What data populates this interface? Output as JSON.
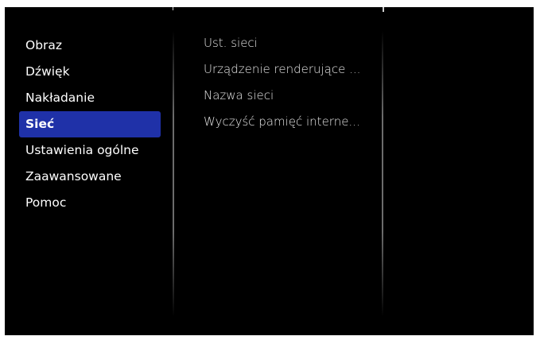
{
  "left_menu": {
    "items": [
      {
        "label": "Obraz"
      },
      {
        "label": "Dźwięk"
      },
      {
        "label": "Nakładanie"
      },
      {
        "label": "Sieć",
        "selected": true
      },
      {
        "label": "Ustawienia ogólne"
      },
      {
        "label": "Zaawansowane"
      },
      {
        "label": "Pomoc"
      }
    ]
  },
  "sub_menu": {
    "items": [
      {
        "label": "Ust. sieci"
      },
      {
        "label": "Urządzenie renderujące ..."
      },
      {
        "label": "Nazwa sieci"
      },
      {
        "label": "Wyczyść pamięć interne..."
      }
    ]
  },
  "colors": {
    "background": "#000000",
    "selection": "#1f31a8",
    "text": "#ffffff"
  }
}
